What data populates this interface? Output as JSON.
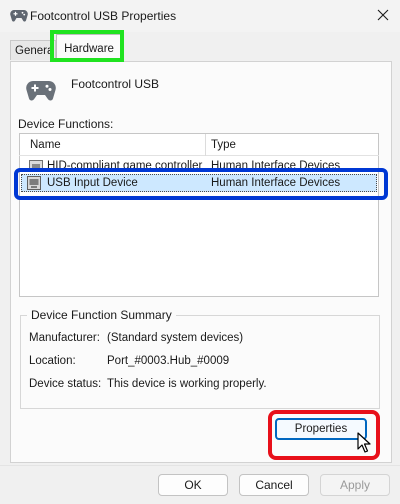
{
  "window": {
    "title": "Footcontrol USB Properties",
    "icon": "gamepad-icon",
    "close_icon": "close-icon"
  },
  "tabs": [
    {
      "label": "General",
      "shown_text": "Genera",
      "active": false
    },
    {
      "label": "Hardware",
      "active": true
    }
  ],
  "device": {
    "name": "Footcontrol USB",
    "icon": "gamepad-icon"
  },
  "device_functions": {
    "label": "Device Functions:",
    "columns": [
      "Name",
      "Type"
    ],
    "rows": [
      {
        "name": "HID-compliant game controller",
        "type": "Human Interface Devices",
        "icon": "hid-device-icon",
        "selected": false
      },
      {
        "name": "USB Input Device",
        "type": "Human Interface Devices",
        "icon": "hid-device-icon",
        "selected": true
      }
    ]
  },
  "summary": {
    "title": "Device Function Summary",
    "manufacturer_label": "Manufacturer:",
    "manufacturer": "(Standard system devices)",
    "location_label": "Location:",
    "location": "Port_#0003.Hub_#0009",
    "status_label": "Device status:",
    "status": "This device is working properly."
  },
  "buttons": {
    "properties": "Properties",
    "ok": "OK",
    "cancel": "Cancel",
    "apply": "Apply"
  },
  "colors": {
    "selection": "#cde8ff",
    "accent": "#0067c0",
    "annotation_green": "#20e320",
    "annotation_blue": "#0038d4",
    "annotation_red": "#e8101a"
  }
}
